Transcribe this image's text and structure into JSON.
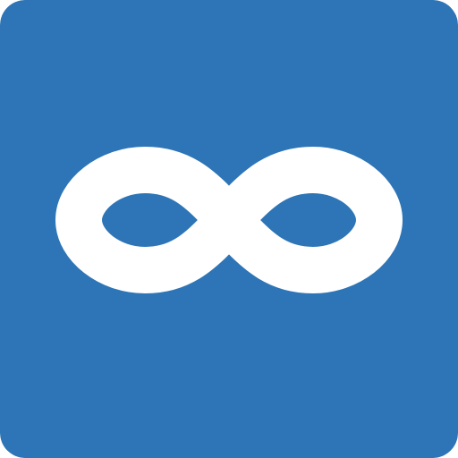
{
  "icon": {
    "name": "infinity-icon",
    "background_color": "#2D75B6",
    "symbol_color": "#FFFFFF"
  }
}
